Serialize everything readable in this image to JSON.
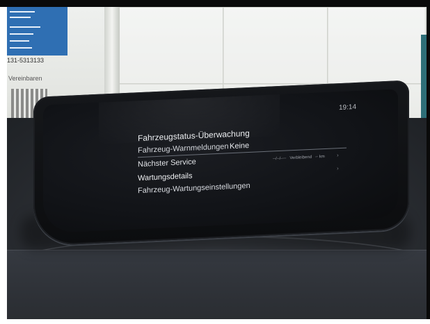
{
  "scene": {
    "background_sign": {
      "phone_number": "131-5313133",
      "appointment_text": "Vereinbaren"
    }
  },
  "display": {
    "clock": "19:14",
    "menu_title": "Fahrzeugstatus-Überwachung",
    "items": [
      {
        "label": "Fahrzeug-Warnmeldungen",
        "value": "Keine"
      },
      {
        "label": "Nächster Service",
        "value_date": "--/--/----",
        "value_remaining_label": "Verbleibend",
        "value_distance": "-- km"
      },
      {
        "label": "Wartungsdetails"
      },
      {
        "label": "Fahrzeug-Wartungseinstellungen"
      }
    ]
  },
  "colors": {
    "screen_background": "#111317",
    "text_primary": "#e9ebee",
    "sign_blue": "#2f6fb3"
  }
}
